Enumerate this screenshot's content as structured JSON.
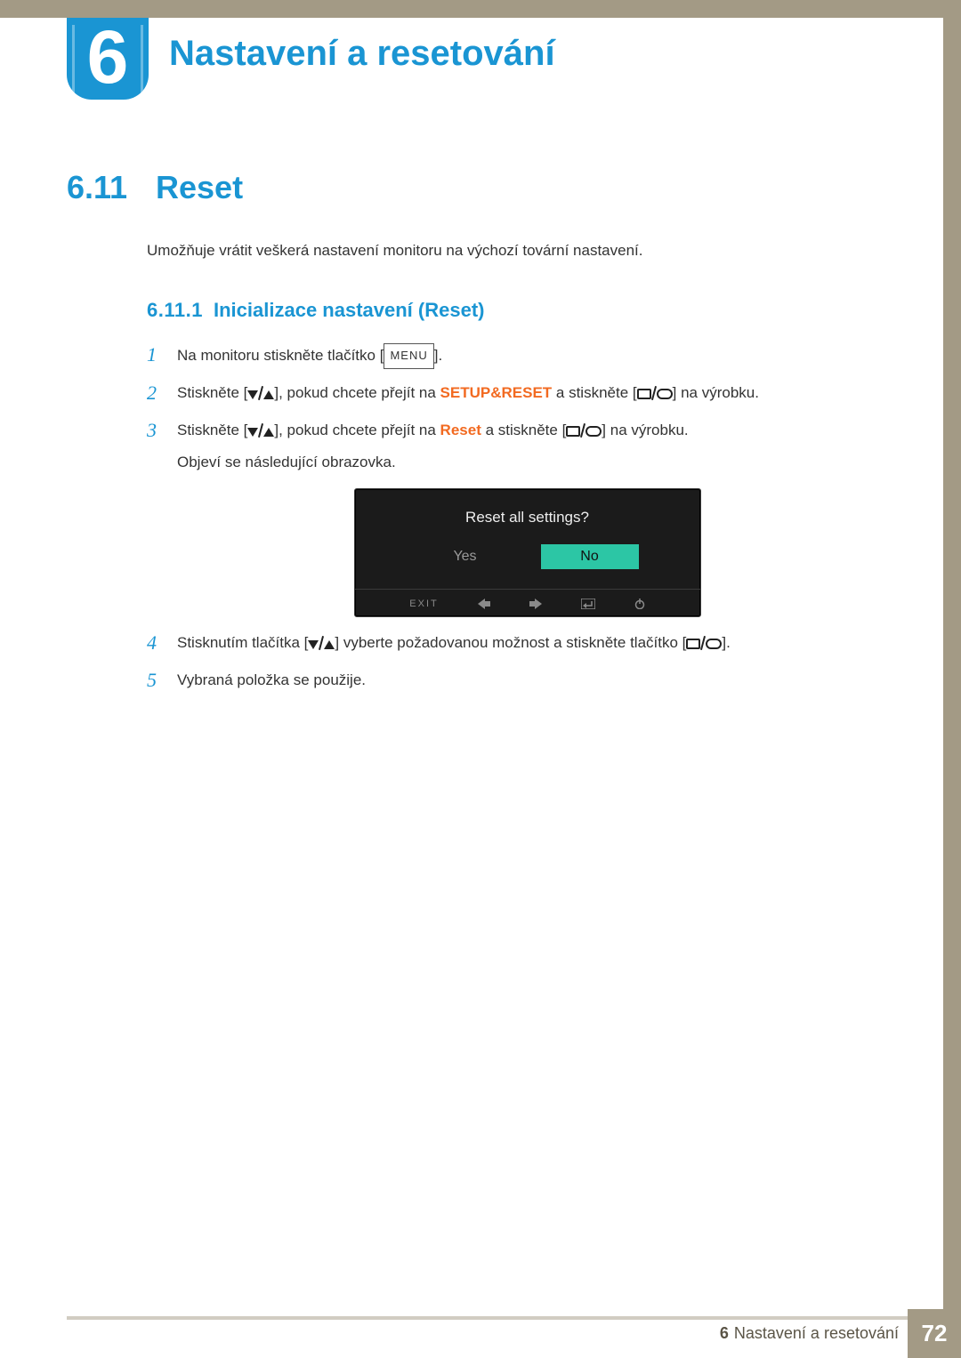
{
  "chapter": {
    "number": "6",
    "title": "Nastavení a resetování"
  },
  "section": {
    "number": "6.11",
    "title": "Reset",
    "intro": "Umožňuje vrátit veškerá nastavení monitoru na výchozí tovární nastavení."
  },
  "subsection": {
    "number": "6.11.1",
    "title": "Inicializace nastavení (Reset)"
  },
  "steps": {
    "s1": {
      "num": "1",
      "a": "Na monitoru stiskněte tlačítko [",
      "menu": "MENU",
      "b": "]."
    },
    "s2": {
      "num": "2",
      "a": "Stiskněte [",
      "b": "], pokud chcete přejít na ",
      "kw": "SETUP&RESET",
      "c": " a stiskněte [",
      "d": "] na výrobku."
    },
    "s3": {
      "num": "3",
      "a": "Stiskněte [",
      "b": "], pokud chcete přejít na ",
      "kw": "Reset",
      "c": " a stiskněte [",
      "d": "] na výrobku.",
      "sub": "Objeví se následující obrazovka."
    },
    "s4": {
      "num": "4",
      "a": "Stisknutím tlačítka [",
      "b": "] vyberte požadovanou možnost a stiskněte tlačítko [",
      "c": "]."
    },
    "s5": {
      "num": "5",
      "a": "Vybraná položka se použije."
    }
  },
  "osd": {
    "title": "Reset all settings?",
    "yes": "Yes",
    "no": "No",
    "exit": "EXIT"
  },
  "footer": {
    "chapterNum": "6",
    "chapterTitle": "Nastavení a resetování",
    "page": "72"
  }
}
